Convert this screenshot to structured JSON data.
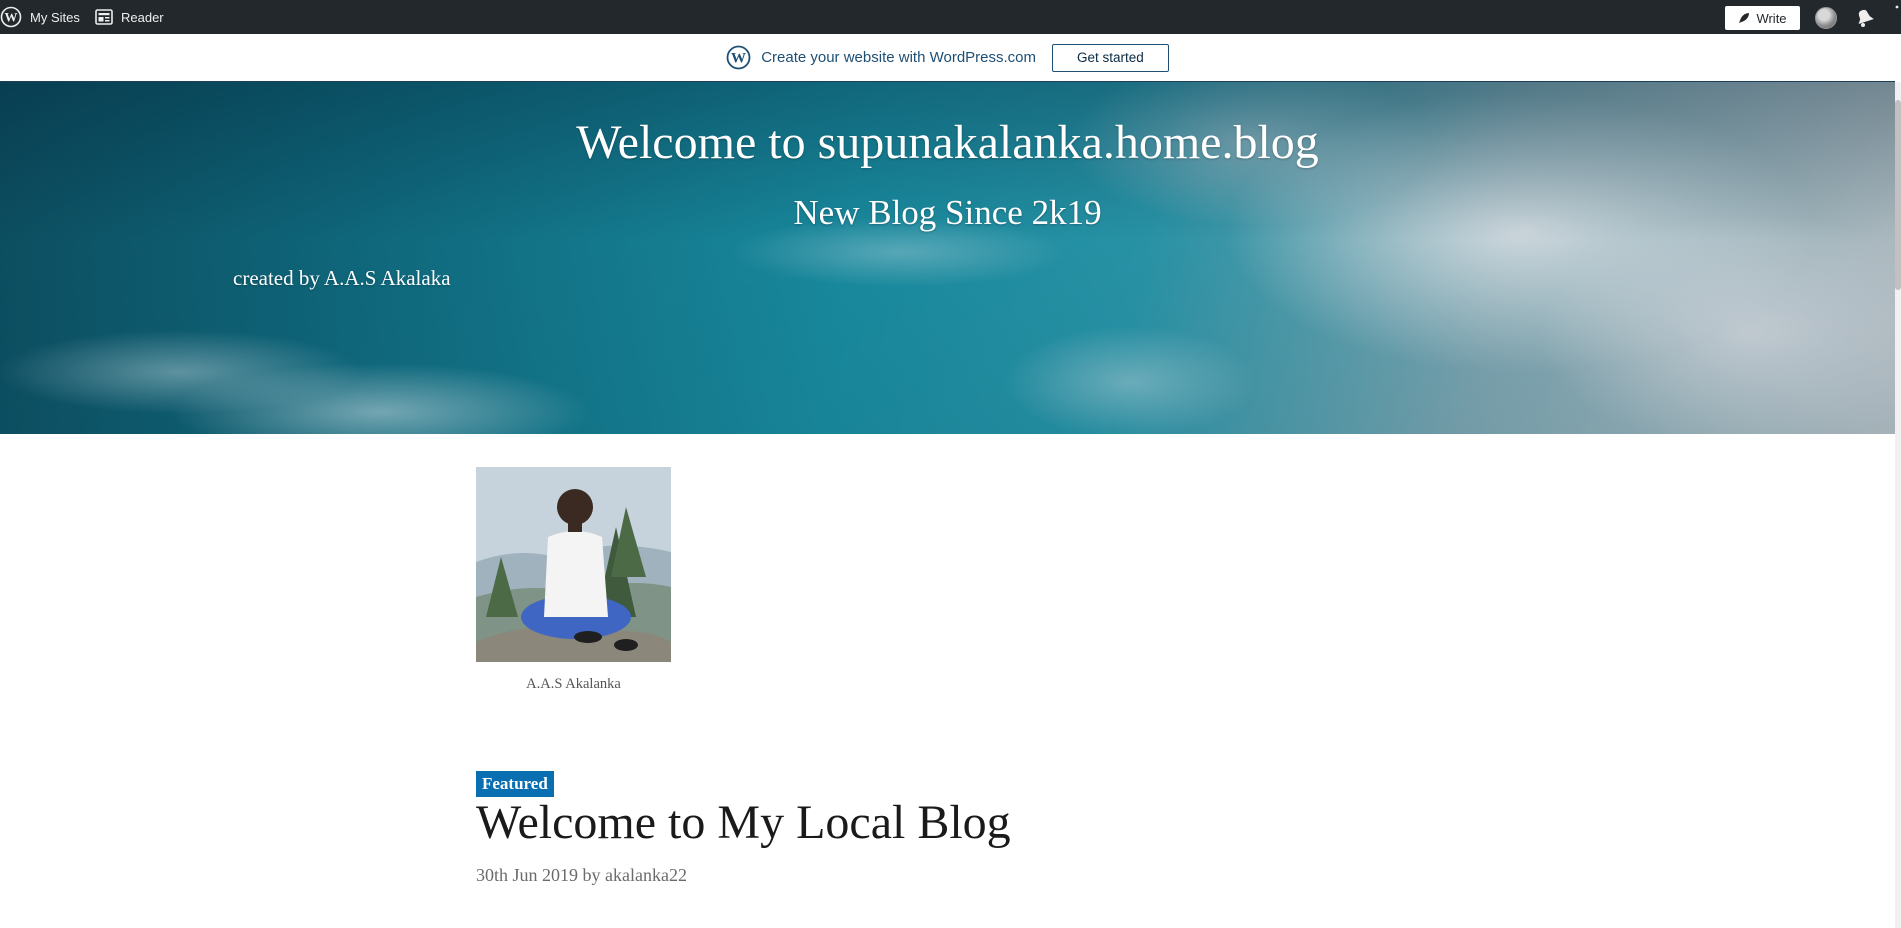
{
  "admin_bar": {
    "my_sites_label": "My Sites",
    "reader_label": "Reader",
    "write_label": "Write",
    "icons": [
      "wordpress-logo-icon",
      "reader-icon",
      "pen-icon",
      "avatar",
      "bell-icon"
    ]
  },
  "promo": {
    "text": "Create your website with WordPress.com",
    "button_label": "Get started"
  },
  "header": {
    "title": "Welcome to supunakalanka.home.blog",
    "tagline": "New Blog Since 2k19",
    "credit": "created by A.A.S Akalaka"
  },
  "profile": {
    "caption": "A.A.S Akalanka"
  },
  "post": {
    "badge": "Featured",
    "title": "Welcome to My Local Blog",
    "date": "30th Jun 2019",
    "by": "by",
    "author": "akalanka22"
  },
  "colors": {
    "admin_bar_bg": "#23282d",
    "promo_text": "#1d4f74",
    "badge_bg": "#0a6fb0"
  }
}
